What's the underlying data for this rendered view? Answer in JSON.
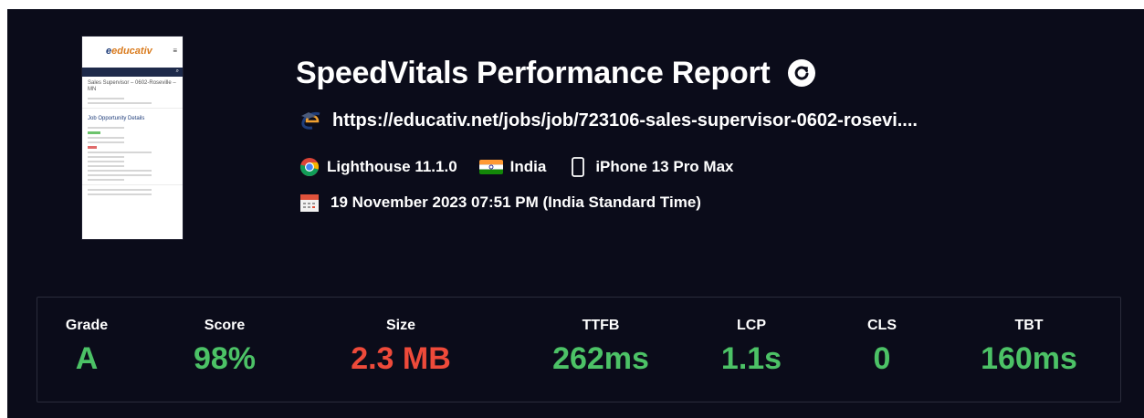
{
  "report": {
    "title": "SpeedVitals Performance Report",
    "url": "https://educativ.net/jobs/job/723106-sales-supervisor-0602-rosevi....",
    "lighthouse": "Lighthouse 11.1.0",
    "location": "India",
    "device": "iPhone 13 Pro Max",
    "date": "19 November 2023 07:51 PM (India Standard Time)"
  },
  "thumbnail": {
    "logo": "educativ",
    "heading": "Sales Supervisor – 0602-Roseville – MN",
    "section": "Job Opportunity Details",
    "fields": [
      "Type",
      "Salary",
      "Work from home",
      "Weekly Working Hours",
      "Positions",
      "Working Location"
    ]
  },
  "metrics": [
    {
      "label": "Grade",
      "value": "A",
      "color": "#4cc266"
    },
    {
      "label": "Score",
      "value": "98%",
      "color": "#4cc266"
    },
    {
      "label": "Size",
      "value": "2.3 MB",
      "color": "#ee4a3a"
    },
    {
      "label": "TTFB",
      "value": "262ms",
      "color": "#4cc266"
    },
    {
      "label": "LCP",
      "value": "1.1s",
      "color": "#4cc266"
    },
    {
      "label": "CLS",
      "value": "0",
      "color": "#4cc266"
    },
    {
      "label": "TBT",
      "value": "160ms",
      "color": "#4cc266"
    }
  ],
  "colors": {
    "background": "#0b0c1a",
    "good": "#4cc266",
    "bad": "#ee4a3a"
  }
}
